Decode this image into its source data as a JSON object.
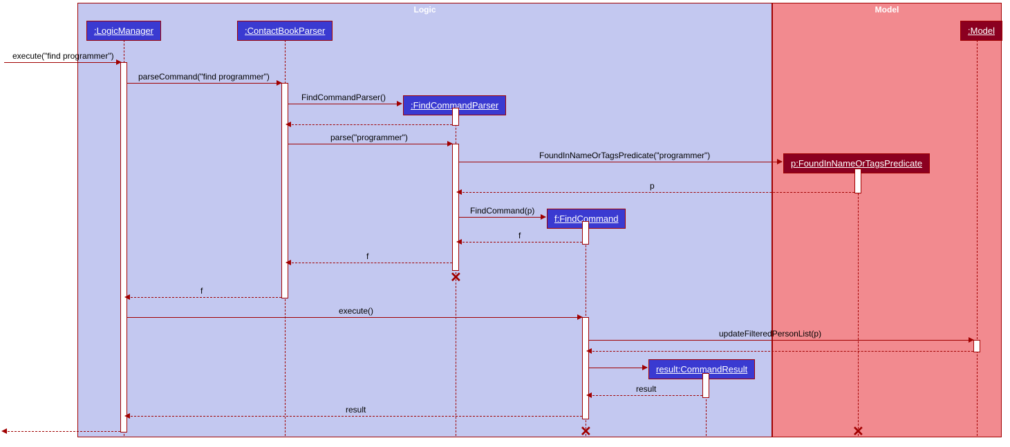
{
  "frames": {
    "logic": "Logic",
    "model": "Model"
  },
  "participants": {
    "logicManager": ":LogicManager",
    "contactBookParser": ":ContactBookParser",
    "findCommandParser": ":FindCommandParser",
    "findCommand": "f:FindCommand",
    "commandResult": "result:CommandResult",
    "predicate": "p:FoundInNameOrTagsPredicate",
    "model": ":Model"
  },
  "messages": {
    "execute_find": "execute(\"find programmer\")",
    "parseCommand": "parseCommand(\"find programmer\")",
    "findCommandParserCtor": "FindCommandParser()",
    "parse_programmer": "parse(\"programmer\")",
    "predicateCtor": "FoundInNameOrTagsPredicate(\"programmer\")",
    "return_p": "p",
    "findCommandCtor": "FindCommand(p)",
    "return_f1": "f",
    "return_f2": "f",
    "return_f3": "f",
    "execute": "execute()",
    "updateFiltered": "updateFilteredPersonList(p)",
    "return_result1": "result",
    "return_result2": "result"
  },
  "chart_data": {
    "type": "sequence_diagram",
    "frames": [
      {
        "name": "Logic",
        "participants": [
          "LogicManager",
          "ContactBookParser",
          "FindCommandParser",
          "f:FindCommand",
          "result:CommandResult"
        ]
      },
      {
        "name": "Model",
        "participants": [
          "p:FoundInNameOrTagsPredicate",
          "Model"
        ]
      }
    ],
    "participants": [
      {
        "id": "LM",
        "label": ":LogicManager",
        "created": "pre",
        "frame": "Logic"
      },
      {
        "id": "CBP",
        "label": ":ContactBookParser",
        "created": "pre",
        "frame": "Logic"
      },
      {
        "id": "FCP",
        "label": ":FindCommandParser",
        "created": "runtime",
        "frame": "Logic"
      },
      {
        "id": "FC",
        "label": "f:FindCommand",
        "created": "runtime",
        "frame": "Logic"
      },
      {
        "id": "CR",
        "label": "result:CommandResult",
        "created": "runtime",
        "frame": "Logic"
      },
      {
        "id": "PRED",
        "label": "p:FoundInNameOrTagsPredicate",
        "created": "runtime",
        "frame": "Model"
      },
      {
        "id": "MDL",
        "label": ":Model",
        "created": "pre",
        "frame": "Model"
      }
    ],
    "messages": [
      {
        "from": "ext",
        "to": "LM",
        "label": "execute(\"find programmer\")",
        "type": "sync"
      },
      {
        "from": "LM",
        "to": "CBP",
        "label": "parseCommand(\"find programmer\")",
        "type": "sync"
      },
      {
        "from": "CBP",
        "to": "FCP",
        "label": "FindCommandParser()",
        "type": "create"
      },
      {
        "from": "FCP",
        "to": "CBP",
        "label": "",
        "type": "return"
      },
      {
        "from": "CBP",
        "to": "FCP",
        "label": "parse(\"programmer\")",
        "type": "sync"
      },
      {
        "from": "FCP",
        "to": "PRED",
        "label": "FoundInNameOrTagsPredicate(\"programmer\")",
        "type": "create"
      },
      {
        "from": "PRED",
        "to": "FCP",
        "label": "p",
        "type": "return"
      },
      {
        "from": "FCP",
        "to": "FC",
        "label": "FindCommand(p)",
        "type": "create"
      },
      {
        "from": "FC",
        "to": "FCP",
        "label": "f",
        "type": "return"
      },
      {
        "from": "FCP",
        "to": "CBP",
        "label": "f",
        "type": "return",
        "note": "FCP destroyed"
      },
      {
        "from": "CBP",
        "to": "LM",
        "label": "f",
        "type": "return"
      },
      {
        "from": "LM",
        "to": "FC",
        "label": "execute()",
        "type": "sync"
      },
      {
        "from": "FC",
        "to": "MDL",
        "label": "updateFilteredPersonList(p)",
        "type": "sync"
      },
      {
        "from": "MDL",
        "to": "FC",
        "label": "",
        "type": "return"
      },
      {
        "from": "FC",
        "to": "CR",
        "label": "",
        "type": "create"
      },
      {
        "from": "CR",
        "to": "FC",
        "label": "result",
        "type": "return"
      },
      {
        "from": "FC",
        "to": "LM",
        "label": "result",
        "type": "return",
        "note": "FC destroyed"
      },
      {
        "from": "LM",
        "to": "ext",
        "label": "",
        "type": "return"
      }
    ],
    "destroyed": [
      "FCP",
      "FC",
      "PRED"
    ]
  }
}
